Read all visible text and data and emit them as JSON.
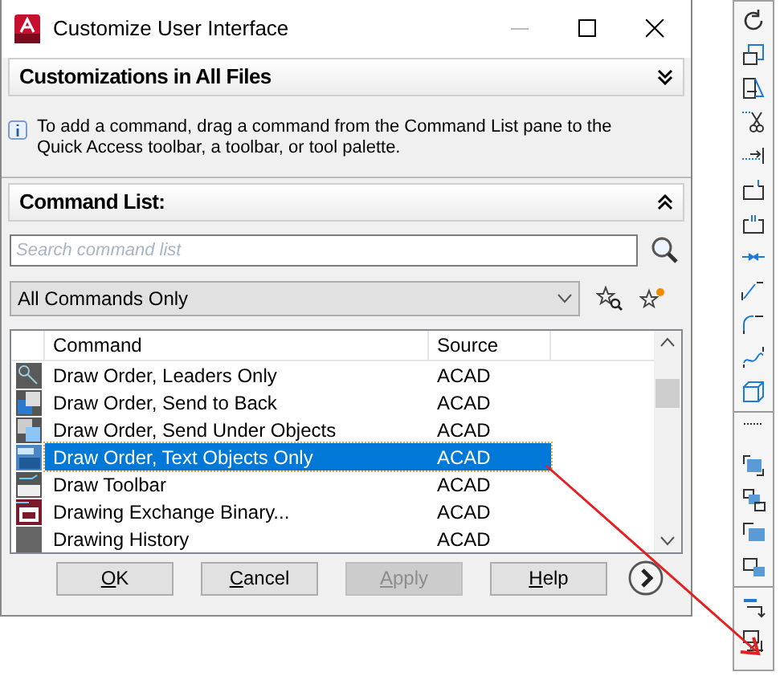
{
  "window": {
    "title": "Customize User Interface"
  },
  "customizations_panel": {
    "title": "Customizations in All Files",
    "expanded": false
  },
  "info": "To add a command, drag a command from the Command List pane to the Quick Access toolbar, a toolbar, or tool palette.",
  "command_list_panel": {
    "title": "Command List:",
    "expanded": true
  },
  "search": {
    "placeholder": "Search command list"
  },
  "filter": {
    "value": "All Commands Only"
  },
  "table": {
    "columns": [
      "Command",
      "Source"
    ],
    "rows": [
      {
        "command": "Draw Order, Leaders Only",
        "source": "ACAD",
        "selected": false
      },
      {
        "command": "Draw Order, Send to Back",
        "source": "ACAD",
        "selected": false
      },
      {
        "command": "Draw Order, Send Under Objects",
        "source": "ACAD",
        "selected": false
      },
      {
        "command": "Draw Order, Text Objects Only",
        "source": "ACAD",
        "selected": true
      },
      {
        "command": "Draw Toolbar",
        "source": "ACAD",
        "selected": false
      },
      {
        "command": "Drawing Exchange Binary...",
        "source": "ACAD",
        "selected": false
      },
      {
        "command": "Drawing History",
        "source": "ACAD",
        "selected": false
      }
    ]
  },
  "buttons": [
    {
      "label": "OK",
      "disabled": false
    },
    {
      "label": "Cancel",
      "disabled": false
    },
    {
      "label": "Apply",
      "disabled": true
    },
    {
      "label": "Help",
      "disabled": false
    }
  ]
}
